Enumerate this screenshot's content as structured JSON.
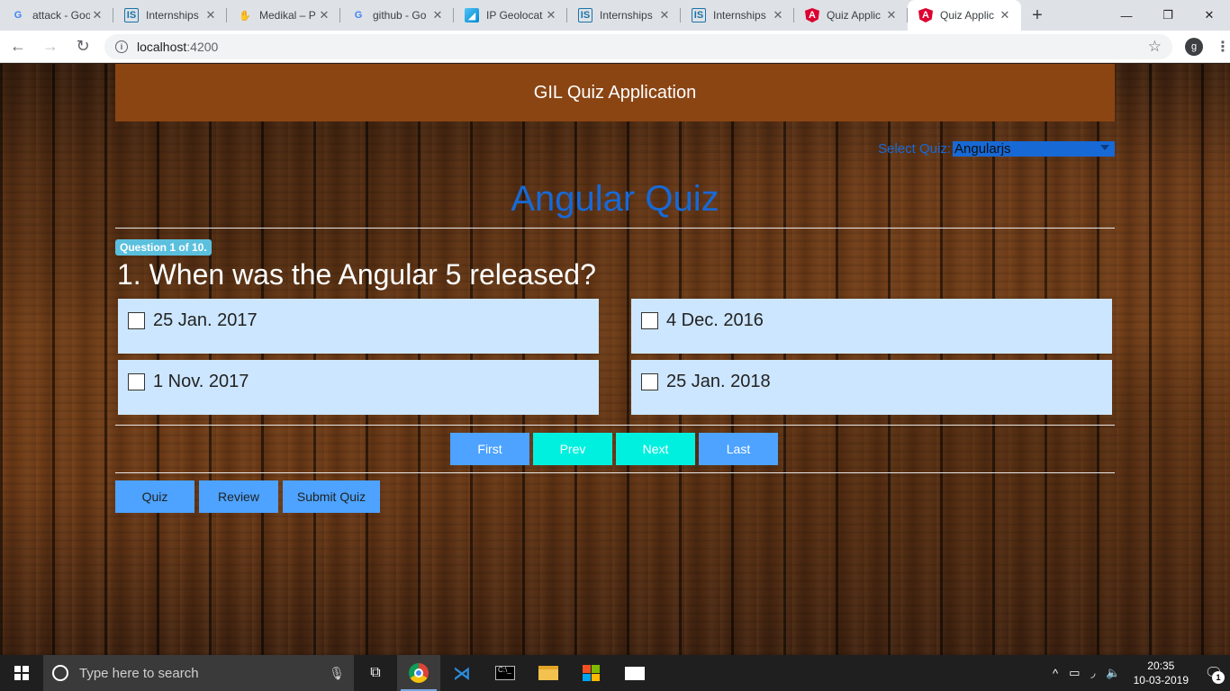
{
  "browser": {
    "tabs": [
      {
        "favicon": "google-g-icon",
        "title": "attack - Goo"
      },
      {
        "favicon": "internshala-icon",
        "title": "Internships"
      },
      {
        "favicon": "hand-icon",
        "title": "Medikal – P"
      },
      {
        "favicon": "google-g-icon",
        "title": "github - Go"
      },
      {
        "favicon": "ip-geolocation-icon",
        "title": "IP Geolocat"
      },
      {
        "favicon": "internshala-icon",
        "title": "Internships"
      },
      {
        "favicon": "internshala-icon",
        "title": "Internships"
      },
      {
        "favicon": "angular-icon",
        "title": "Quiz Applic"
      },
      {
        "favicon": "angular-icon",
        "title": "Quiz Applic",
        "active": true
      }
    ],
    "address": {
      "host": "localhost",
      "port": ":4200"
    },
    "profile_initial": "g"
  },
  "app": {
    "header_title": "GIL Quiz Application",
    "select_label": "Select Quiz:",
    "select_value": "Angularjs",
    "quiz_title": "Angular Quiz",
    "question_badge": "Question 1 of 10.",
    "question_text": "1. When was the Angular 5 released?",
    "options": [
      "25 Jan. 2017",
      "4 Dec. 2016",
      "1 Nov. 2017",
      "25 Jan. 2018"
    ],
    "pager": {
      "first": "First",
      "prev": "Prev",
      "next": "Next",
      "last": "Last"
    },
    "modes": {
      "quiz": "Quiz",
      "review": "Review",
      "submit": "Submit Quiz"
    },
    "colors": {
      "header": "#8b4513",
      "accent_blue": "#1769d6",
      "option_bg": "#cce6ff",
      "button_blue": "#4da3ff",
      "button_cyan": "#00f0e0",
      "badge": "#5bc0de"
    }
  },
  "taskbar": {
    "search_placeholder": "Type here to search",
    "time": "20:35",
    "date": "10-03-2019",
    "notification_count": "1"
  }
}
